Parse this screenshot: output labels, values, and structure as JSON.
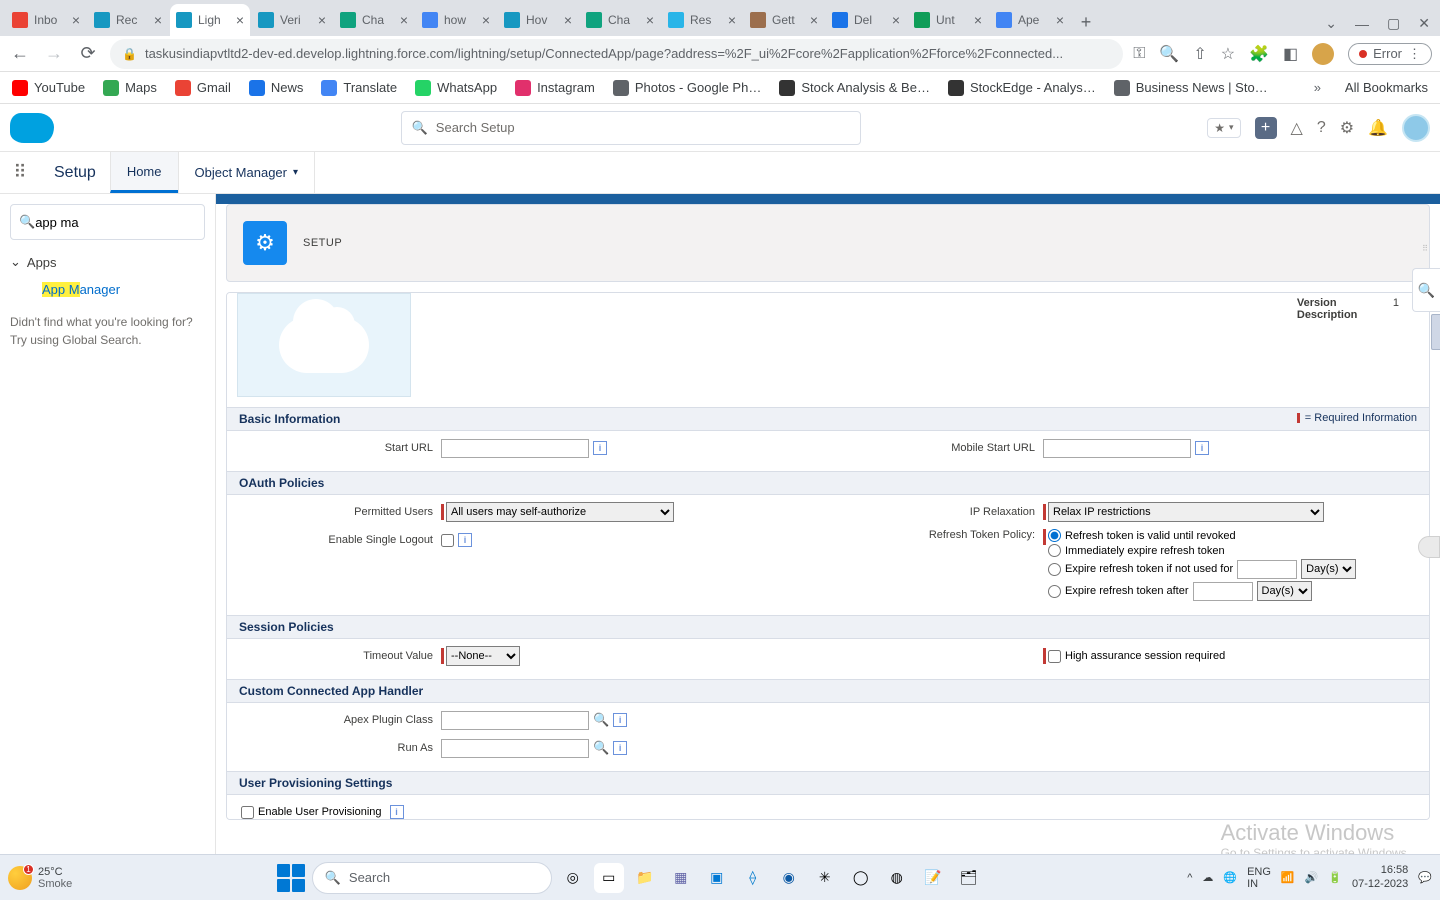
{
  "browser": {
    "tabs": [
      {
        "title": "Inbo",
        "favcolor": "#ea4335"
      },
      {
        "title": "Rec",
        "favcolor": "#1798c1"
      },
      {
        "title": "Ligh",
        "favcolor": "#1798c1",
        "active": true
      },
      {
        "title": "Veri",
        "favcolor": "#1798c1"
      },
      {
        "title": "Cha",
        "favcolor": "#10a37f"
      },
      {
        "title": "how",
        "favcolor": "#4285f4"
      },
      {
        "title": "Hov",
        "favcolor": "#1798c1"
      },
      {
        "title": "Cha",
        "favcolor": "#10a37f"
      },
      {
        "title": "Res",
        "favcolor": "#29b5e8"
      },
      {
        "title": "Gett",
        "favcolor": "#9c6f4e"
      },
      {
        "title": "Del",
        "favcolor": "#1a73e8"
      },
      {
        "title": "Unt",
        "favcolor": "#0f9d58"
      },
      {
        "title": "Ape",
        "favcolor": "#4285f4"
      }
    ],
    "url": "taskusindiapvtltd2-dev-ed.develop.lightning.force.com/lightning/setup/ConnectedApp/page?address=%2F_ui%2Fcore%2Fapplication%2Fforce%2Fconnected...",
    "error_label": "Error",
    "bookmarks": [
      {
        "label": "YouTube",
        "color": "#ff0000"
      },
      {
        "label": "Maps",
        "color": "#34a853"
      },
      {
        "label": "Gmail",
        "color": "#ea4335"
      },
      {
        "label": "News",
        "color": "#1a73e8"
      },
      {
        "label": "Translate",
        "color": "#4285f4"
      },
      {
        "label": "WhatsApp",
        "color": "#25d366"
      },
      {
        "label": "Instagram",
        "color": "#e1306c"
      },
      {
        "label": "Photos - Google Ph…",
        "color": "#5f6368"
      },
      {
        "label": "Stock Analysis & Be…",
        "color": "#333333"
      },
      {
        "label": "StockEdge - Analys…",
        "color": "#333333"
      },
      {
        "label": "Business News | Sto…",
        "color": "#5f6368"
      }
    ],
    "all_bookmarks_label": "All Bookmarks"
  },
  "sf": {
    "search_placeholder": "Search Setup",
    "setup_label": "Setup",
    "tabs": {
      "home": "Home",
      "object_manager": "Object Manager"
    },
    "tree": {
      "search_value": "app ma",
      "group": "Apps",
      "item_hl": "App M",
      "item_rest": "anager",
      "hint1": "Didn't find what you're looking for?",
      "hint2": "Try using Global Search."
    },
    "page_header_small": "SETUP",
    "meta": {
      "version_label": "Version",
      "version_val": "1",
      "desc_label": "Description"
    },
    "sections": {
      "basic": "Basic Information",
      "oauth": "OAuth Policies",
      "session": "Session Policies",
      "handler": "Custom Connected App Handler",
      "provisioning": "User Provisioning Settings"
    },
    "required_info": "= Required Information",
    "fields": {
      "start_url": "Start URL",
      "mobile_start_url": "Mobile Start URL",
      "permitted_users": "Permitted Users",
      "permitted_users_val": "All users may self-authorize",
      "ip_relax": "IP Relaxation",
      "ip_relax_val": "Relax IP restrictions",
      "enable_slo": "Enable Single Logout",
      "refresh_policy": "Refresh Token Policy:",
      "rt_valid": "Refresh token is valid until revoked",
      "rt_immediate": "Immediately expire refresh token",
      "rt_notused": "Expire refresh token if not used for",
      "rt_after": "Expire refresh token after",
      "days": "Day(s)",
      "timeout": "Timeout Value",
      "timeout_val": "--None--",
      "high_assurance": "High assurance session required",
      "apex_class": "Apex Plugin Class",
      "run_as": "Run As",
      "enable_up": "Enable User Provisioning"
    }
  },
  "watermark": {
    "title": "Activate Windows",
    "sub": "Go to Settings to activate Windows."
  },
  "taskbar": {
    "temp": "25°C",
    "cond": "Smoke",
    "badge": "1",
    "search_placeholder": "Search",
    "lang1": "ENG",
    "lang2": "IN",
    "time": "16:58",
    "date": "07-12-2023"
  }
}
